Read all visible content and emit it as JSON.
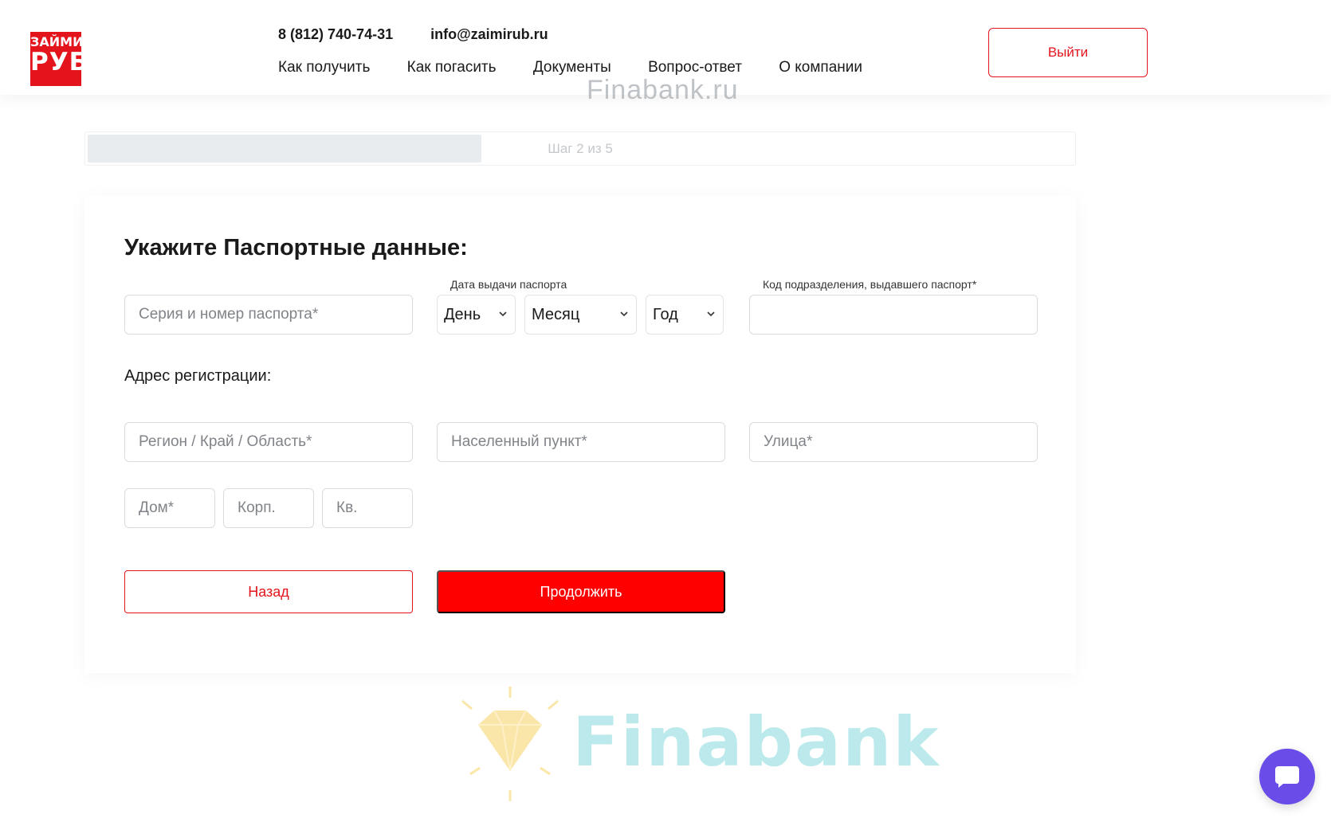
{
  "brand": {
    "logo_line1": "ЗАЙМИ",
    "logo_line2": "РУБ"
  },
  "header": {
    "phone": "8 (812) 740-74-31",
    "email": "info@zaimirub.ru",
    "nav": [
      "Как получить",
      "Как погасить",
      "Документы",
      "Вопрос-ответ",
      "О компании"
    ],
    "logout_label": "Выйти"
  },
  "watermark_top": "Finabank.ru",
  "watermark_bottom": "Finabank",
  "progress": {
    "text": "Шаг 2 из 5",
    "step": 2,
    "total": 5,
    "fill_fraction": 0.4
  },
  "form": {
    "title": "Укажите Паспортные данные:",
    "passport_number_placeholder": "Серия и номер паспорта*",
    "issue_date_label": "Дата выдачи паспорта",
    "day_value": "День",
    "month_value": "Месяц",
    "year_value": "Год",
    "division_code_label": "Код подразделения, выдавшего паспорт*",
    "division_code_value": "",
    "address_label": "Адрес регистрации:",
    "region_placeholder": "Регион / Край / Область*",
    "city_placeholder": "Населенный пункт*",
    "street_placeholder": "Улица*",
    "house_placeholder": "Дом*",
    "building_placeholder": "Корп.",
    "apartment_placeholder": "Кв.",
    "back_label": "Назад",
    "continue_label": "Продолжить"
  },
  "colors": {
    "accent": "#e3141c",
    "primary_button": "#ff0000",
    "chat": "#6a4ce8"
  }
}
